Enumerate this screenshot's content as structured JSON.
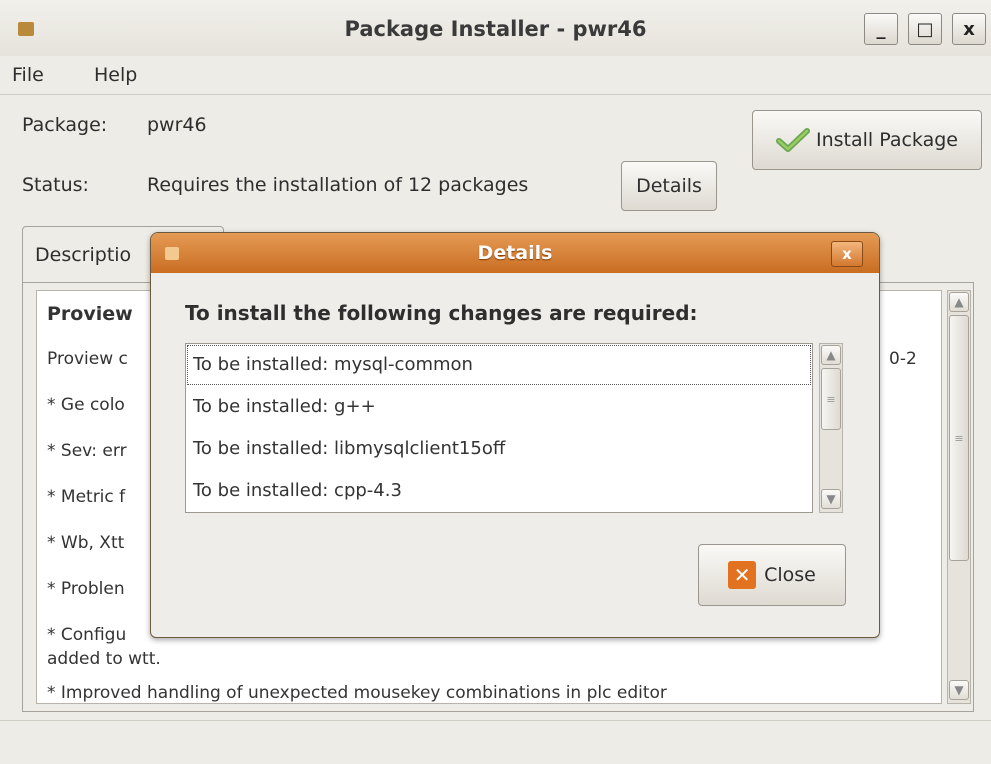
{
  "window": {
    "title": "Package Installer - pwr46",
    "controls": {
      "minimize": "_",
      "maximize": "□",
      "close": "x"
    }
  },
  "menu": {
    "file": "File",
    "help": "Help"
  },
  "package": {
    "label": "Package:",
    "value": "pwr46"
  },
  "status": {
    "label": "Status:",
    "value": "Requires the installation of 12 packages",
    "details_button": "Details"
  },
  "install_button": "Install Package",
  "tab": {
    "label": "Descriptio"
  },
  "description": {
    "lines": [
      "Proview",
      "Proview c",
      "* Ge colo",
      "* Sev: err",
      "* Metric f",
      "* Wb, Xtt",
      "* Problen",
      "* Configu",
      "added to wtt.",
      "* Improved handling of unexpected mousekey combinations in plc editor"
    ],
    "right_fragment": "0-2"
  },
  "dialog": {
    "title": "Details",
    "close_x": "x",
    "heading": "To install the following changes are required:",
    "items": [
      "To be installed: mysql-common",
      "To be installed: g++",
      "To be installed: libmysqlclient15off",
      "To be installed: cpp-4.3"
    ],
    "close_button": "Close"
  }
}
